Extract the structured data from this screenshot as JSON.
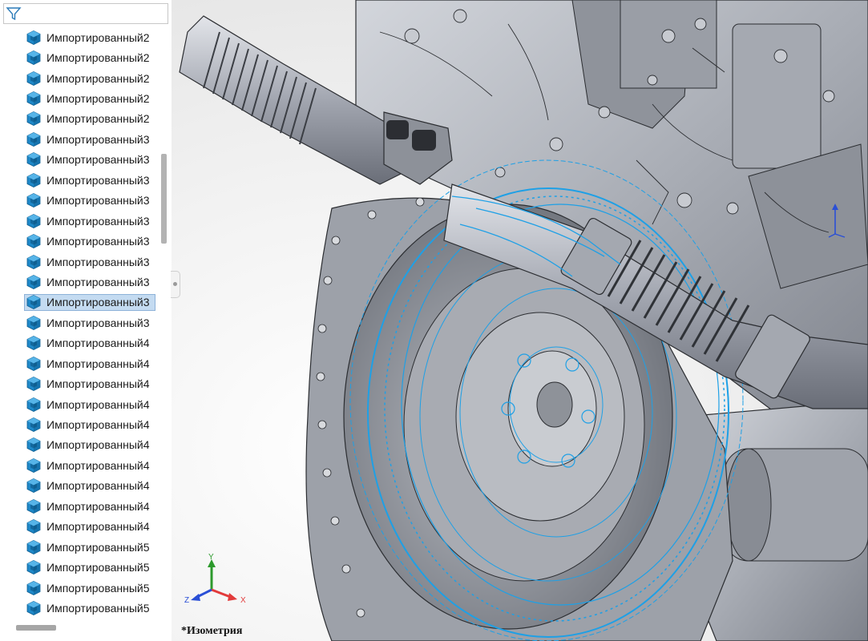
{
  "tree": {
    "items": [
      {
        "label": "Импортированный2",
        "selected": false
      },
      {
        "label": "Импортированный2",
        "selected": false
      },
      {
        "label": "Импортированный2",
        "selected": false
      },
      {
        "label": "Импортированный2",
        "selected": false
      },
      {
        "label": "Импортированный2",
        "selected": false
      },
      {
        "label": "Импортированный3",
        "selected": false
      },
      {
        "label": "Импортированный3",
        "selected": false
      },
      {
        "label": "Импортированный3",
        "selected": false
      },
      {
        "label": "Импортированный3",
        "selected": false
      },
      {
        "label": "Импортированный3",
        "selected": false
      },
      {
        "label": "Импортированный3",
        "selected": false
      },
      {
        "label": "Импортированный3",
        "selected": false
      },
      {
        "label": "Импортированный3",
        "selected": false
      },
      {
        "label": "Импортированный3",
        "selected": true
      },
      {
        "label": "Импортированный3",
        "selected": false
      },
      {
        "label": "Импортированный4",
        "selected": false
      },
      {
        "label": "Импортированный4",
        "selected": false
      },
      {
        "label": "Импортированный4",
        "selected": false
      },
      {
        "label": "Импортированный4",
        "selected": false
      },
      {
        "label": "Импортированный4",
        "selected": false
      },
      {
        "label": "Импортированный4",
        "selected": false
      },
      {
        "label": "Импортированный4",
        "selected": false
      },
      {
        "label": "Импортированный4",
        "selected": false
      },
      {
        "label": "Импортированный4",
        "selected": false
      },
      {
        "label": "Импортированный4",
        "selected": false
      },
      {
        "label": "Импортированный5",
        "selected": false
      },
      {
        "label": "Импортированный5",
        "selected": false
      },
      {
        "label": "Импортированный5",
        "selected": false
      },
      {
        "label": "Импортированный5",
        "selected": false
      }
    ]
  },
  "viewport": {
    "view_label": "*Изометрия",
    "triad": {
      "x_label": "X",
      "y_label": "Y",
      "z_label": "Z"
    }
  },
  "icons": {
    "filter": "filter-funnel-icon",
    "part": "imported-part-cube-icon"
  },
  "colors": {
    "selection_highlight": "#1ea0e6",
    "part_icon": "#1e88c8",
    "row_selected_bg": "#c4dbf1",
    "model_metal": "#b8bcc4",
    "axis_x": "#e23b3b",
    "axis_y": "#2d9a2d",
    "axis_z": "#2a4fd6"
  }
}
